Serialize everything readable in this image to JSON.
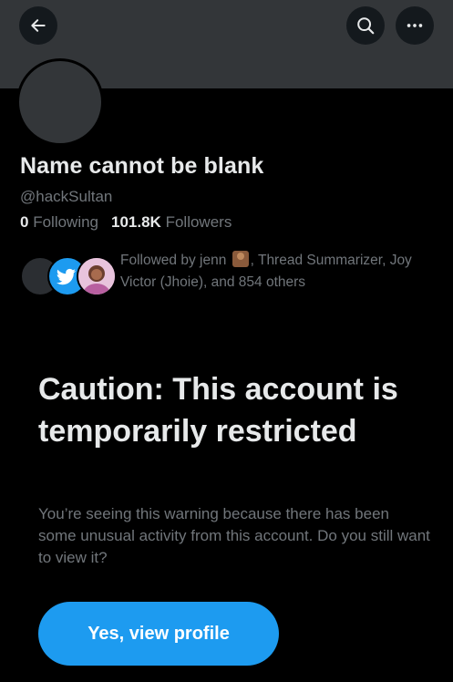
{
  "icons": {
    "back": "back-arrow-icon",
    "search": "search-icon",
    "more": "more-options-icon"
  },
  "colors": {
    "accent": "#1d9bf0",
    "banner": "#333639",
    "background": "#000000",
    "secondary_text": "#71767b"
  },
  "profile": {
    "name": "Name cannot be blank",
    "handle": "@hackSultan",
    "following_count": "0",
    "following_label": "Following",
    "followers_count": "101.8K",
    "followers_label": "Followers",
    "followed_by_prefix": "Followed by jenn",
    "followed_by_rest": ", Thread Summarizer, Joy Victor (Jhoie), and 854 others"
  },
  "warning": {
    "title": "Caution: This account is temporarily restricted",
    "body": "You’re seeing this warning because there has been some unusual activity from this account. Do you still want to view it?",
    "button_label": "Yes, view profile"
  }
}
